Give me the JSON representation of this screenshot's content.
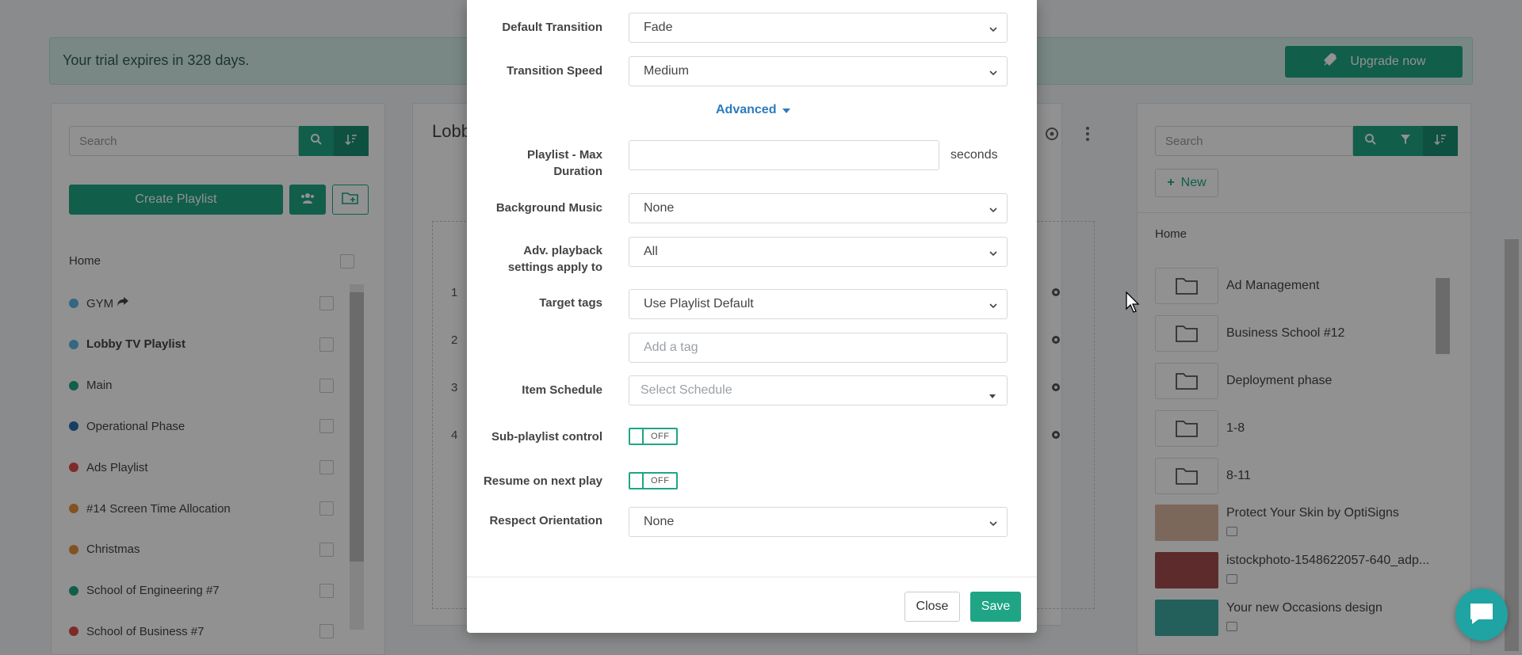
{
  "trial": {
    "message": "Your trial expires in 328 days.",
    "upgrade_label": "Upgrade now"
  },
  "left": {
    "search_placeholder": "Search",
    "create_label": "Create Playlist",
    "home_label": "Home",
    "playlists": [
      {
        "name": "GYM",
        "color": "#5db3e6"
      },
      {
        "name": "Lobby TV Playlist",
        "color": "#5db3e6"
      },
      {
        "name": "Main",
        "color": "#1fa585"
      },
      {
        "name": "Operational Phase",
        "color": "#2b6cb0"
      },
      {
        "name": "Ads Playlist",
        "color": "#e04b4b"
      },
      {
        "name": "#14 Screen Time Allocation",
        "color": "#e6913a"
      },
      {
        "name": "Christmas",
        "color": "#e6913a"
      },
      {
        "name": "School of Engineering #7",
        "color": "#1fa585"
      },
      {
        "name": "School of Business #7",
        "color": "#e04b4b"
      }
    ]
  },
  "middle": {
    "title_partial": "Lobb",
    "rows": [
      "1",
      "2",
      "3",
      "4"
    ]
  },
  "right": {
    "search_placeholder": "Search",
    "new_label": "New",
    "home_label": "Home",
    "folders": [
      "Ad Management",
      "Business School #12",
      "Deployment phase",
      "1-8",
      "8-11"
    ],
    "media": [
      {
        "name": "Protect Your Skin by OptiSigns",
        "type_icon": "image-icon"
      },
      {
        "name": "istockphoto-1548622057-640_adp...",
        "type_icon": "film-icon"
      },
      {
        "name": "Your new Occasions design",
        "type_icon": "design-icon"
      }
    ]
  },
  "modal": {
    "fields": {
      "default_transition": {
        "label": "Default Transition",
        "value": "Fade"
      },
      "transition_speed": {
        "label": "Transition Speed",
        "value": "Medium"
      },
      "advanced_label": "Advanced",
      "max_duration": {
        "label": "Playlist - Max Duration",
        "value": "",
        "unit": "seconds"
      },
      "background_music": {
        "label": "Background Music",
        "value": "None"
      },
      "adv_playback": {
        "label": "Adv. playback settings apply to",
        "value": "All"
      },
      "target_tags": {
        "label": "Target tags",
        "value": "Use Playlist Default",
        "tag_placeholder": "Add a tag"
      },
      "item_schedule": {
        "label": "Item Schedule",
        "placeholder": "Select Schedule"
      },
      "sub_playlist": {
        "label": "Sub-playlist control",
        "state": "OFF"
      },
      "resume": {
        "label": "Resume on next play",
        "state": "OFF"
      },
      "respect_orientation": {
        "label": "Respect Orientation",
        "value": "None"
      }
    },
    "close_label": "Close",
    "save_label": "Save"
  },
  "colors": {
    "accent": "#1fa585",
    "link": "#2b7bbf"
  }
}
